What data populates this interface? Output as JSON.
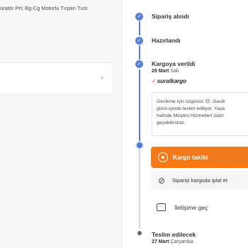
{
  "left_panel": {
    "product_title": "üratör Prc Bg-Cg Motorlu Tırpan Tum",
    "row_chevron": "›"
  },
  "timeline": {
    "steps": [
      {
        "label": "Sipariş alındı",
        "status": "done"
      },
      {
        "label": "Hazırlandı",
        "status": "done"
      },
      {
        "label": "Kargoya verildi",
        "date_bold": "26 Mart",
        "date_day": "Salı",
        "status": "done"
      },
      {
        "label": "Teslim edilecek",
        "date_bold": "27 Mart",
        "date_day": "Çarşamba",
        "status": "pending"
      }
    ],
    "carrier": {
      "name": "suratkargo",
      "mark": "✓"
    },
    "message": "Gecikme için üzgünüz 😕. Gecik\ngünü içinde teslim ediliyor. Yaşa\nhalinde Müşteri Hizmetleri üzeri\ngeçebilirsiniz.",
    "check_glyph": "✓"
  },
  "actions": {
    "track_label": "Kargo takibi",
    "cancel_label": "Siparişi kargoda iptal et",
    "cancel_icon": "⊘",
    "contact_label": "İletişime geç",
    "contact_icon": "…"
  },
  "colors": {
    "accent": "#f27a1a",
    "timeline": "#5a7fd0",
    "carrier": "#e2231a"
  }
}
